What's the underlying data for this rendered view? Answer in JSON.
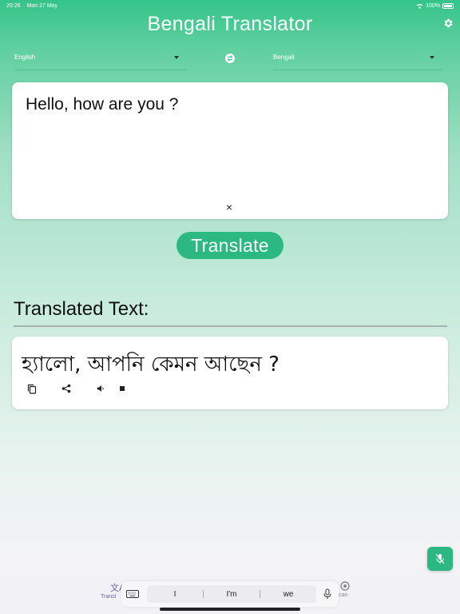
{
  "status_bar": {
    "time": "20:26",
    "date": "Mon 27 May",
    "battery": "100%"
  },
  "app": {
    "title": "Bengali Translator"
  },
  "languages": {
    "source": "English",
    "target": "Bengali"
  },
  "input": {
    "text": "Hello, how are you ?",
    "clear_symbol": "×"
  },
  "translate_button": {
    "label": "Translate"
  },
  "output": {
    "section_title": "Translated Text:",
    "text": "হ্যালো, আপনি কেমন আছেন ?"
  },
  "bottom_nav": {
    "left_label": "Transl",
    "right_label": "can"
  },
  "keyboard_suggestions": [
    "I",
    "I'm",
    "we"
  ],
  "colors": {
    "accent": "#2bb981",
    "header": "#34c48a"
  },
  "icons": [
    "settings-icon",
    "swap-icon",
    "copy-icon",
    "share-icon",
    "speaker-icon",
    "stop-icon",
    "mic-off-icon",
    "keyboard-icon",
    "mic-icon"
  ]
}
